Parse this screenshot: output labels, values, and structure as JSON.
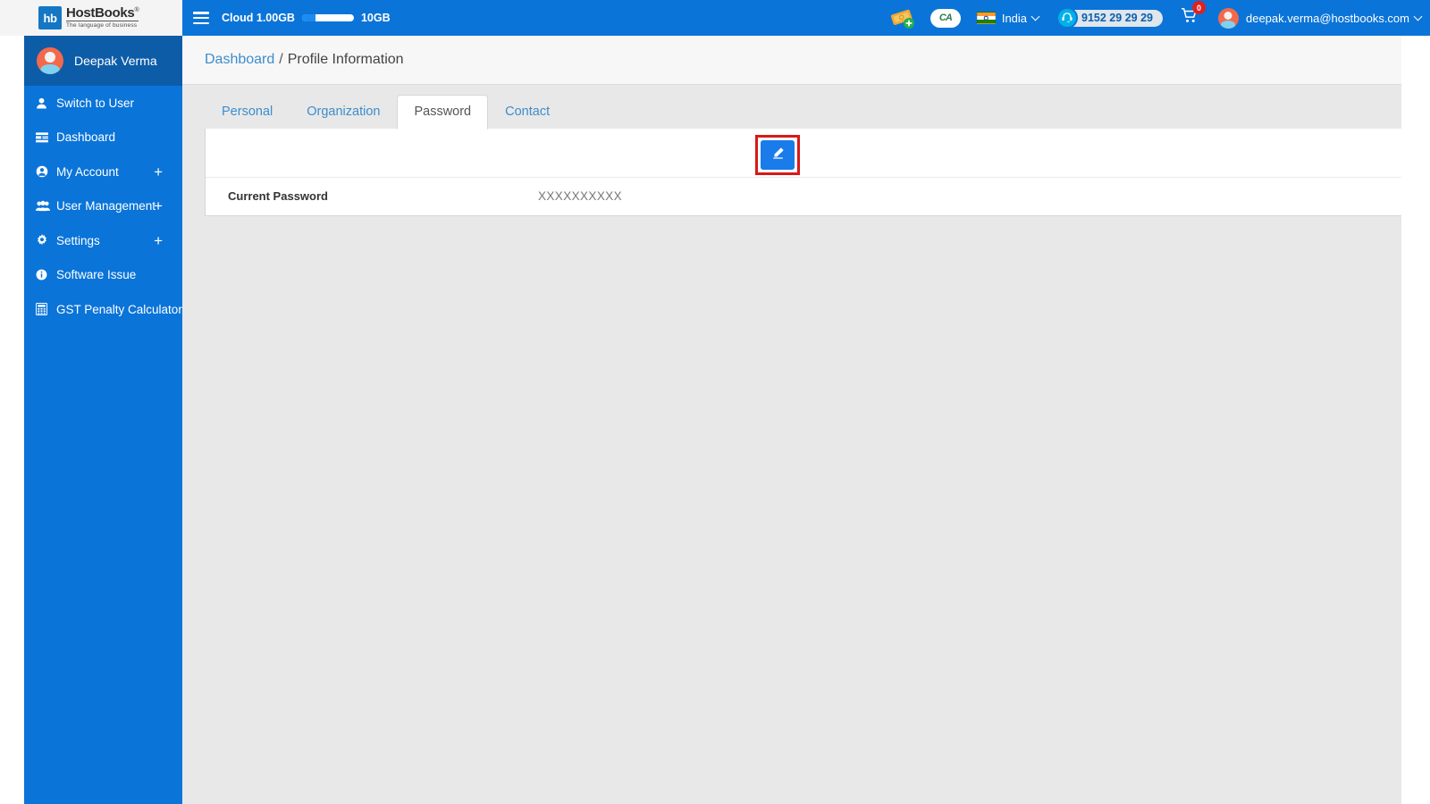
{
  "brand": {
    "logo_badge": "hb",
    "name": "HostBooks",
    "registered_mark": "®",
    "tagline": "The language of business"
  },
  "topbar": {
    "menu_icon": "hamburger-icon",
    "cloud_label": "Cloud 1.00GB",
    "cloud_max": "10GB",
    "cloud_used_percent": 10,
    "ticket_icon": "add-ticket-icon",
    "ca_badge": "CA",
    "country": "India",
    "country_flag": "india-flag-icon",
    "support_phone": "9152 29 29 29",
    "support_icon": "headset-icon",
    "cart_icon": "shopping-cart-icon",
    "cart_count": "0",
    "user_email": "deepak.verma@hostbooks.com",
    "user_avatar": "user-avatar"
  },
  "sidebar": {
    "profile_name": "Deepak Verma",
    "profile_avatar": "user-avatar",
    "items": [
      {
        "label": "Switch to User",
        "icon": "user-icon",
        "expandable": false
      },
      {
        "label": "Dashboard",
        "icon": "dashboard-icon",
        "expandable": false
      },
      {
        "label": "My Account",
        "icon": "account-circle-icon",
        "expandable": true,
        "plus": "+"
      },
      {
        "label": "User Management",
        "icon": "users-group-icon",
        "expandable": true,
        "plus": "+"
      },
      {
        "label": "Settings",
        "icon": "gear-icon",
        "expandable": true,
        "plus": "+"
      },
      {
        "label": "Software Issue",
        "icon": "info-icon",
        "expandable": false
      },
      {
        "label": "GST Penalty Calculator",
        "icon": "calculator-icon",
        "expandable": false
      }
    ]
  },
  "breadcrumb": {
    "root": "Dashboard",
    "separator": "/",
    "current": "Profile Information"
  },
  "tabs": [
    {
      "label": "Personal",
      "active": false
    },
    {
      "label": "Organization",
      "active": false
    },
    {
      "label": "Password",
      "active": true
    },
    {
      "label": "Contact",
      "active": false
    }
  ],
  "password_panel": {
    "edit_button_icon": "pencil-edit-icon",
    "edit_button_highlighted": true,
    "rows": [
      {
        "label": "Current Password",
        "value": "XXXXXXXXXX"
      }
    ]
  },
  "colors": {
    "header_blue": "#0a74d9",
    "sidebar_blue": "#0a74d9",
    "profile_strip_blue": "#0d5ca8",
    "link_blue": "#3c8dcd",
    "edit_button_blue": "#1a7bea",
    "annotation_red": "#d81818",
    "page_background": "#e8e8e8",
    "badge_red": "#e02020"
  }
}
